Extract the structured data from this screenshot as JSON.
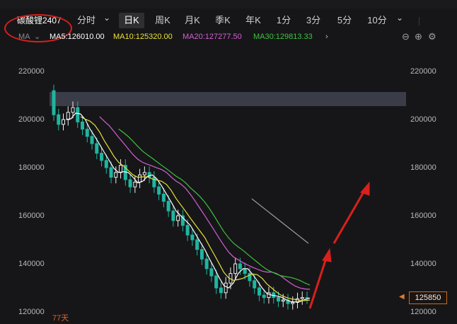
{
  "toolbar": {
    "symbol": "碳酸锂2407",
    "tabs": [
      {
        "label": "分时"
      },
      {
        "label": "日K"
      },
      {
        "label": "周K"
      },
      {
        "label": "月K"
      },
      {
        "label": "季K"
      },
      {
        "label": "年K"
      },
      {
        "label": "1分"
      },
      {
        "label": "3分"
      },
      {
        "label": "5分"
      },
      {
        "label": "10分"
      }
    ],
    "active_tab": "日K"
  },
  "indicators": {
    "ma_label": "MA",
    "ma5": "MA5:126010.00",
    "ma10": "MA10:125320.00",
    "ma20": "MA20:127277.50",
    "ma30": "MA30:129813.33"
  },
  "colors": {
    "ma5": "#ffffff",
    "ma10": "#e8e13a",
    "ma20": "#d45fd6",
    "ma30": "#3dc23d",
    "up": "#f0f0f0",
    "down": "#1fb5a0",
    "annotation": "#d8201c",
    "last_price_tag": "#c86b20"
  },
  "axis": {
    "left_ticks": [
      "220000",
      "200000",
      "180000",
      "160000",
      "140000",
      "120000"
    ],
    "right_ticks": [
      "220000",
      "200000",
      "180000",
      "160000",
      "140000",
      "120000"
    ]
  },
  "last_price": "125850",
  "days_label": "77天",
  "icons": [
    "zoom-out-icon",
    "zoom-in-icon",
    "settings-icon"
  ]
}
